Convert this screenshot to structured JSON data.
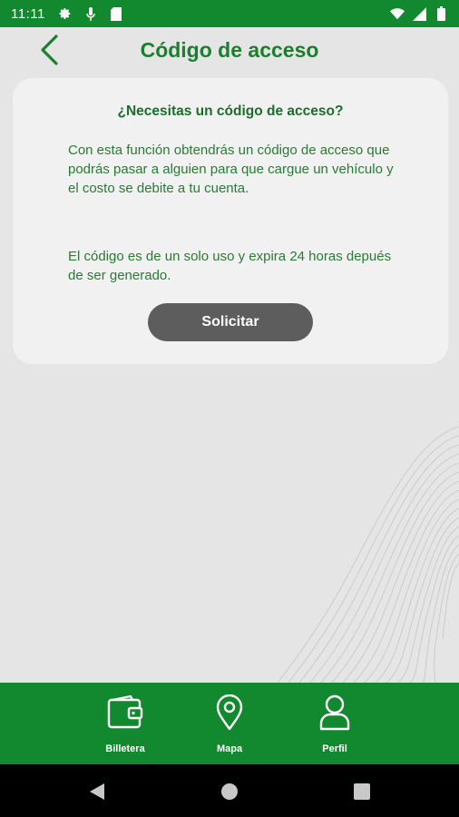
{
  "status_bar": {
    "time": "11:11",
    "icons": [
      "gear-icon",
      "microphone-icon",
      "sd-card-icon",
      "wifi-icon",
      "signal-icon",
      "battery-icon"
    ]
  },
  "header": {
    "title": "Código de acceso",
    "back_icon": "chevron-left-icon"
  },
  "card": {
    "title": "¿Necesitas un código de acceso?",
    "paragraph1": "Con esta función obtendrás un código de acceso que podrás pasar a alguien para que cargue un vehículo y el costo se debite a tu cuenta.",
    "paragraph2": "El código es de un solo uso y expira 24 horas depués de ser generado.",
    "button_label": "Solicitar"
  },
  "bottom_nav": {
    "items": [
      {
        "label": "Billetera",
        "icon": "wallet-icon"
      },
      {
        "label": "Mapa",
        "icon": "map-pin-icon"
      },
      {
        "label": "Perfil",
        "icon": "user-icon"
      }
    ]
  },
  "system_nav": {
    "icons": [
      "back-triangle-icon",
      "home-circle-icon",
      "recents-square-icon"
    ]
  },
  "colors": {
    "brand_green": "#13892f",
    "title_green": "#1a7f2e",
    "text_green": "#2b7a36",
    "button_gray": "#5d5d5d",
    "background": "#e4e5e4"
  }
}
